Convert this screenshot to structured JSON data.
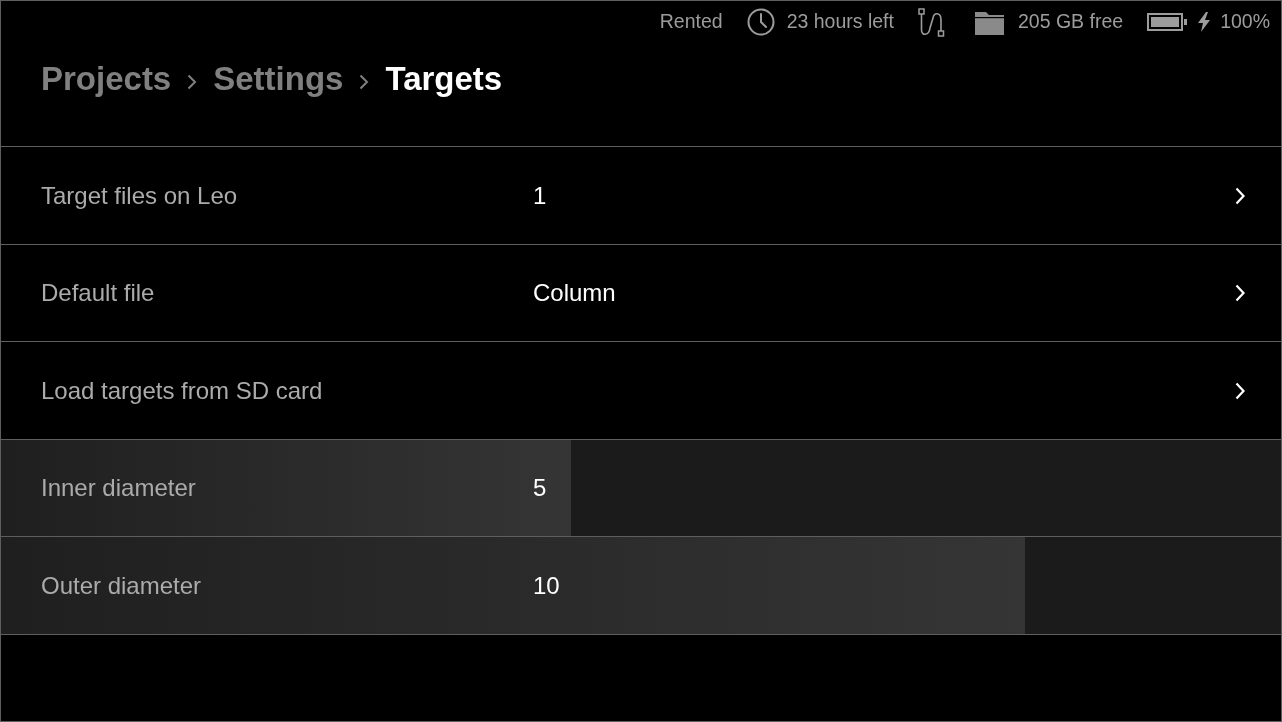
{
  "status_bar": {
    "license": "Rented",
    "time_left": "23 hours left",
    "storage": "205 GB free",
    "charging": true,
    "battery": "100%"
  },
  "breadcrumbs": [
    {
      "label": "Projects",
      "selected": false
    },
    {
      "label": "Settings",
      "selected": false
    },
    {
      "label": "Targets",
      "selected": true
    }
  ],
  "rows": [
    {
      "kind": "link",
      "label": "Target files on Leo",
      "value": "1"
    },
    {
      "kind": "link",
      "label": "Default file",
      "value": "Column"
    },
    {
      "kind": "link",
      "label": "Load targets from SD card"
    },
    {
      "kind": "slider",
      "label": "Inner diameter",
      "value": "5",
      "level": 0.445
    },
    {
      "kind": "slider",
      "label": "Outer diameter",
      "value": "10",
      "level": 0.8
    }
  ]
}
